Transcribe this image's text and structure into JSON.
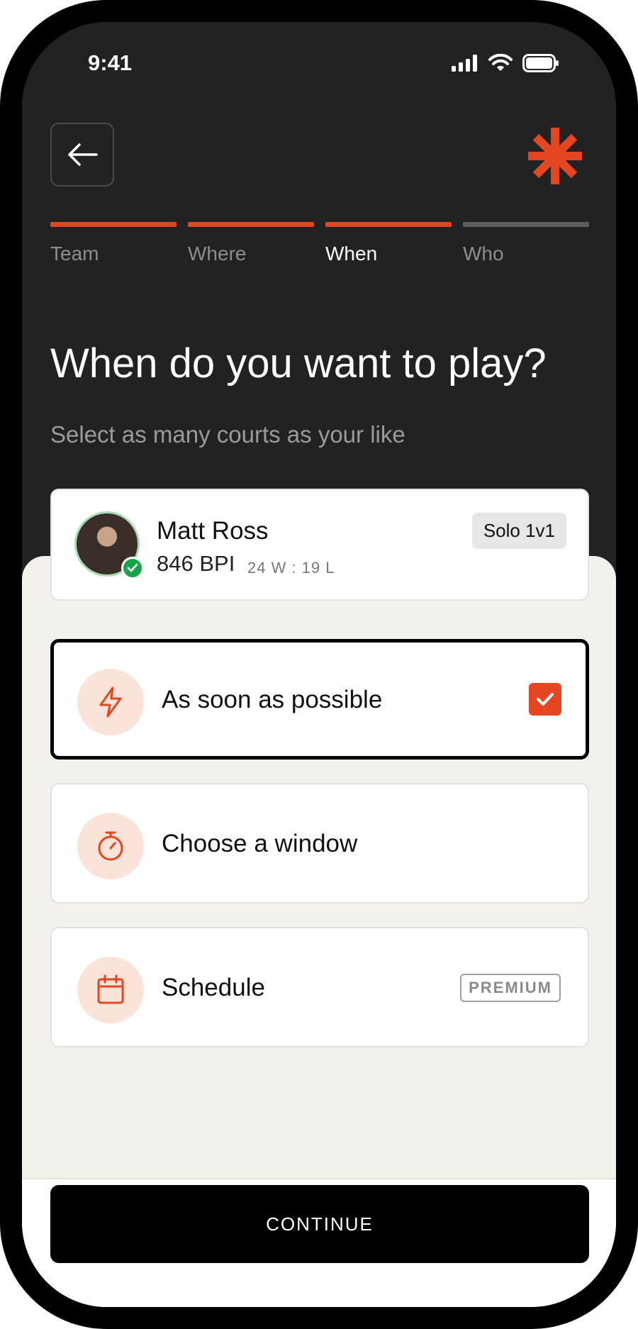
{
  "status_bar": {
    "time": "9:41",
    "icons": [
      "cellular-signal-icon",
      "wifi-icon",
      "battery-icon"
    ]
  },
  "header": {
    "back_icon": "arrow-left-icon",
    "logo_icon": "asterisk-logo-icon"
  },
  "steps": [
    {
      "label": "Team",
      "complete": true,
      "current": false
    },
    {
      "label": "Where",
      "complete": true,
      "current": false
    },
    {
      "label": "When",
      "complete": true,
      "current": true
    },
    {
      "label": "Who",
      "complete": false,
      "current": false
    }
  ],
  "title": "When do you want to play?",
  "subtitle": "Select as many courts as your like",
  "profile": {
    "name": "Matt Ross",
    "rating": "846 BPI",
    "record": "24 W : 19 L",
    "badge": "Solo 1v1",
    "verified": true
  },
  "options": [
    {
      "label": "As soon as possible",
      "icon": "lightning-icon",
      "selected": true
    },
    {
      "label": "Choose a window",
      "icon": "stopwatch-icon",
      "selected": false
    },
    {
      "label": "Schedule",
      "icon": "calendar-icon",
      "selected": false,
      "tag": "PREMIUM"
    }
  ],
  "continue_label": "CONTINUE",
  "colors": {
    "accent": "#e4471f",
    "dark_bg": "#222222",
    "sheet_bg": "#f4f0eb",
    "icon_circle": "#fbe3d9",
    "verified": "#18a54a"
  }
}
